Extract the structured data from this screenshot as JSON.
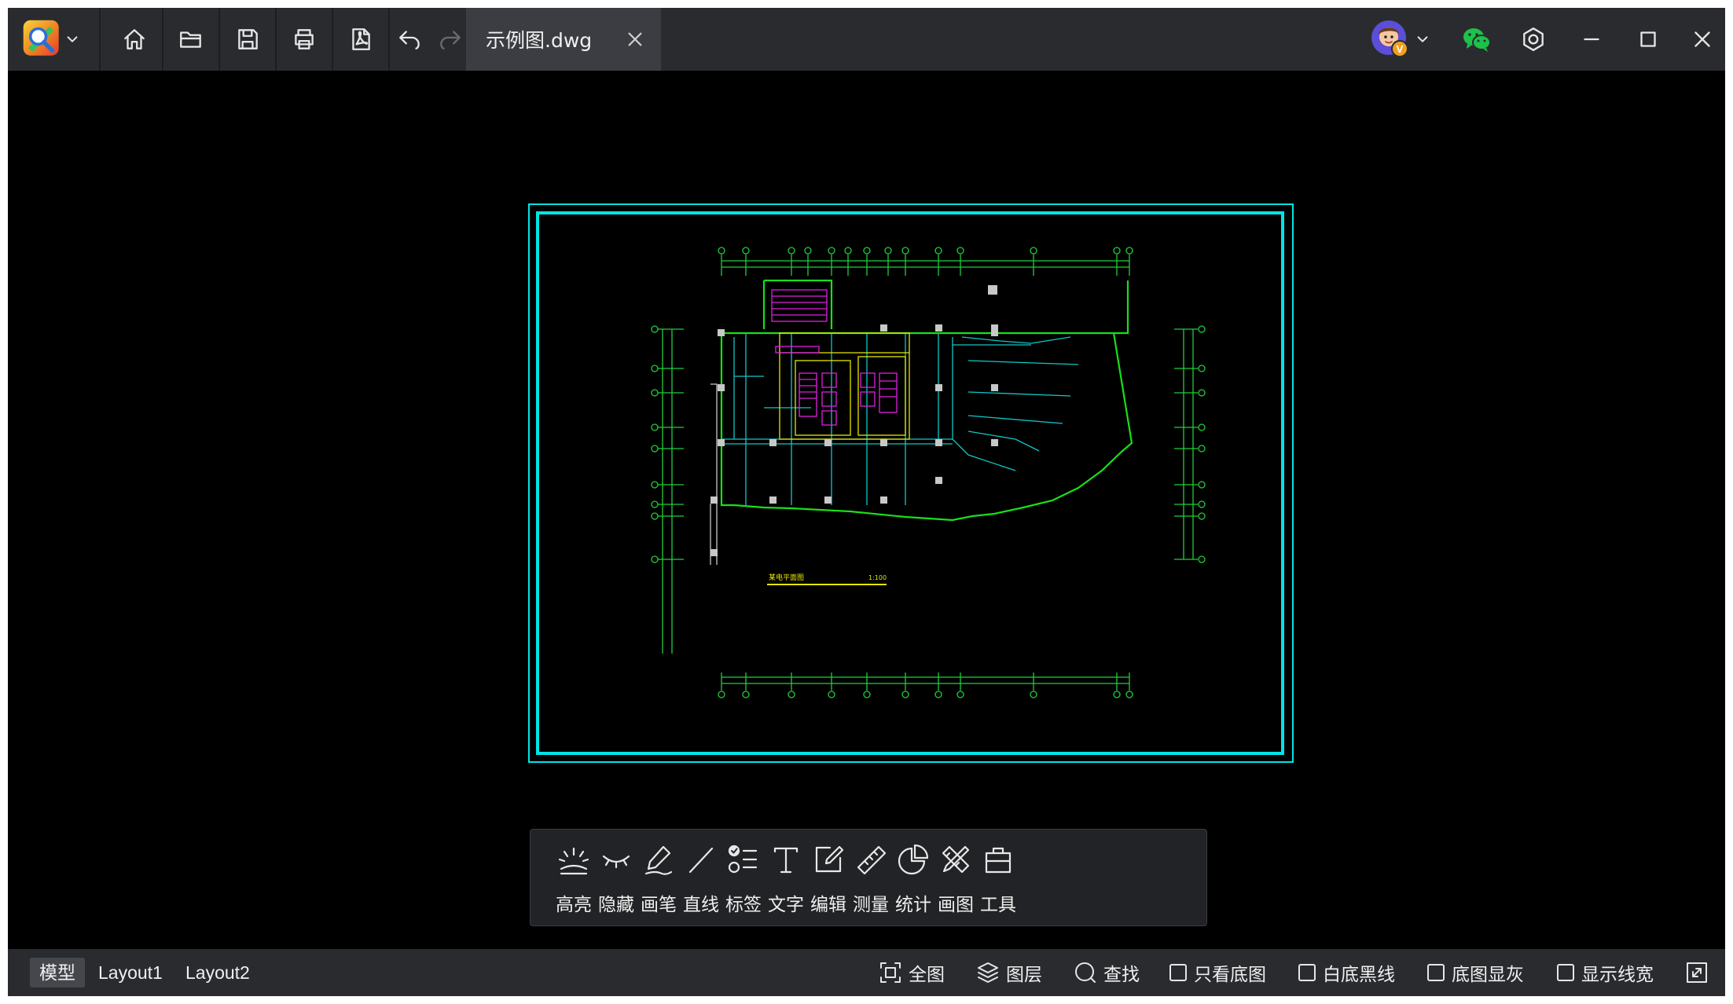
{
  "titlebar": {
    "app_icon": "cad-viewer-logo-icon",
    "nav_icons": [
      "home-icon",
      "folder-open-icon",
      "save-icon",
      "print-icon",
      "pdf-icon",
      "undo-icon",
      "redo-icon"
    ],
    "tab_title": "示例图.dwg",
    "avatar_badge": "V",
    "right_icons": [
      "avatar-icon",
      "wechat-icon",
      "settings-icon",
      "minimize-icon",
      "maximize-icon",
      "close-icon"
    ]
  },
  "drawing": {
    "title": "某电平面图",
    "scale": "1:100",
    "colors": {
      "frame": "#00e5e5",
      "wall": "#18e018",
      "dim": "#1fcf3a",
      "magenta": "#e020e0",
      "yellow": "#e6e600",
      "column": "#c8c8c8",
      "cyan": "#10c8c8"
    }
  },
  "float_toolbar": {
    "tools": [
      {
        "label": "高亮",
        "icon": "highlight-icon"
      },
      {
        "label": "隐藏",
        "icon": "hide-eye-icon"
      },
      {
        "label": "画笔",
        "icon": "pen-icon"
      },
      {
        "label": "直线",
        "icon": "line-icon"
      },
      {
        "label": "标签",
        "icon": "tag-list-icon"
      },
      {
        "label": "文字",
        "icon": "text-icon"
      },
      {
        "label": "编辑",
        "icon": "edit-icon"
      },
      {
        "label": "测量",
        "icon": "ruler-icon"
      },
      {
        "label": "统计",
        "icon": "pie-chart-icon"
      },
      {
        "label": "画图",
        "icon": "draw-tools-icon"
      },
      {
        "label": "工具",
        "icon": "toolbox-icon"
      }
    ]
  },
  "statusbar": {
    "layouts": [
      "模型",
      "Layout1",
      "Layout2"
    ],
    "actions": [
      {
        "label": "全图",
        "icon": "fit-all-icon"
      },
      {
        "label": "图层",
        "icon": "layers-icon"
      },
      {
        "label": "查找",
        "icon": "search-icon"
      }
    ],
    "toggles": [
      {
        "label": "只看底图",
        "checked": false
      },
      {
        "label": "白底黑线",
        "checked": false
      },
      {
        "label": "底图显灰",
        "checked": false
      },
      {
        "label": "显示线宽",
        "checked": false
      }
    ],
    "fullscreen_icon": "expand-icon"
  }
}
